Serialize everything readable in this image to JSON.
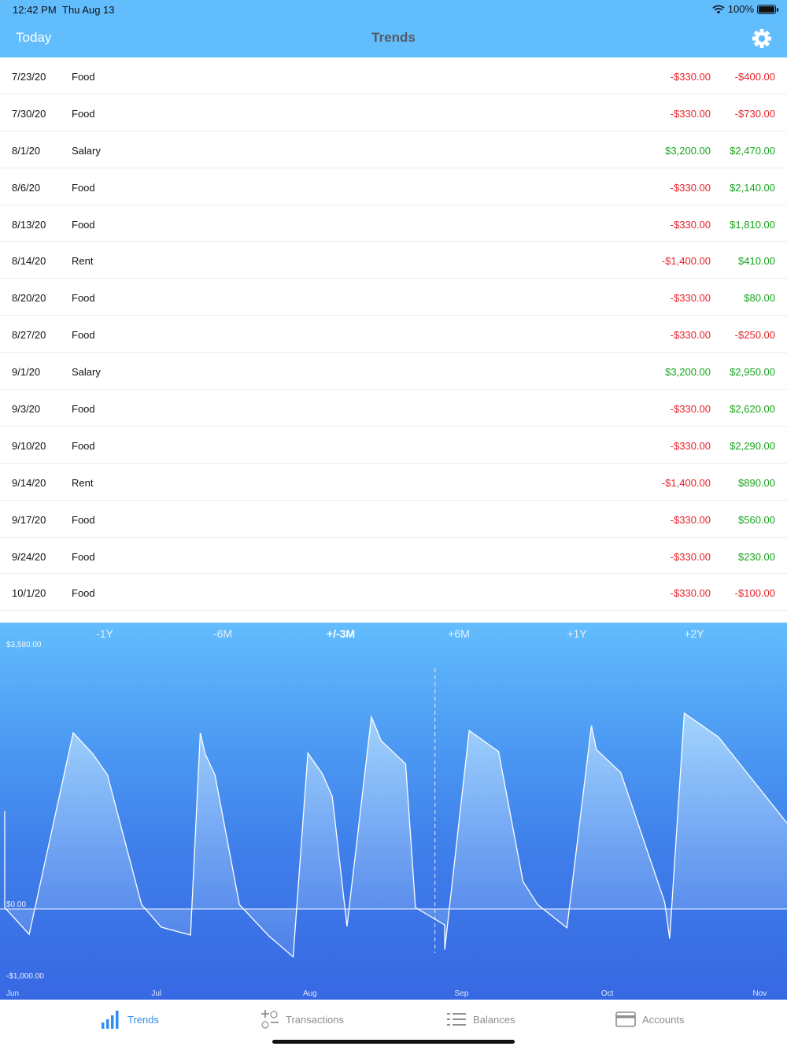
{
  "status": {
    "time": "12:42 PM",
    "date": "Thu Aug 13",
    "battery": "100%"
  },
  "nav": {
    "left": "Today",
    "title": "Trends"
  },
  "transactions": [
    {
      "date": "7/23/20",
      "category": "Food",
      "amount": "-$330.00",
      "balance": "-$400.00",
      "amount_sign": "neg",
      "balance_sign": "neg"
    },
    {
      "date": "7/30/20",
      "category": "Food",
      "amount": "-$330.00",
      "balance": "-$730.00",
      "amount_sign": "neg",
      "balance_sign": "neg"
    },
    {
      "date": "8/1/20",
      "category": "Salary",
      "amount": "$3,200.00",
      "balance": "$2,470.00",
      "amount_sign": "pos",
      "balance_sign": "pos"
    },
    {
      "date": "8/6/20",
      "category": "Food",
      "amount": "-$330.00",
      "balance": "$2,140.00",
      "amount_sign": "neg",
      "balance_sign": "pos"
    },
    {
      "date": "8/13/20",
      "category": "Food",
      "amount": "-$330.00",
      "balance": "$1,810.00",
      "amount_sign": "neg",
      "balance_sign": "pos"
    },
    {
      "date": "8/14/20",
      "category": "Rent",
      "amount": "-$1,400.00",
      "balance": "$410.00",
      "amount_sign": "neg",
      "balance_sign": "pos"
    },
    {
      "date": "8/20/20",
      "category": "Food",
      "amount": "-$330.00",
      "balance": "$80.00",
      "amount_sign": "neg",
      "balance_sign": "pos"
    },
    {
      "date": "8/27/20",
      "category": "Food",
      "amount": "-$330.00",
      "balance": "-$250.00",
      "amount_sign": "neg",
      "balance_sign": "neg"
    },
    {
      "date": "9/1/20",
      "category": "Salary",
      "amount": "$3,200.00",
      "balance": "$2,950.00",
      "amount_sign": "pos",
      "balance_sign": "pos"
    },
    {
      "date": "9/3/20",
      "category": "Food",
      "amount": "-$330.00",
      "balance": "$2,620.00",
      "amount_sign": "neg",
      "balance_sign": "pos"
    },
    {
      "date": "9/10/20",
      "category": "Food",
      "amount": "-$330.00",
      "balance": "$2,290.00",
      "amount_sign": "neg",
      "balance_sign": "pos"
    },
    {
      "date": "9/14/20",
      "category": "Rent",
      "amount": "-$1,400.00",
      "balance": "$890.00",
      "amount_sign": "neg",
      "balance_sign": "pos"
    },
    {
      "date": "9/17/20",
      "category": "Food",
      "amount": "-$330.00",
      "balance": "$560.00",
      "amount_sign": "neg",
      "balance_sign": "pos"
    },
    {
      "date": "9/24/20",
      "category": "Food",
      "amount": "-$330.00",
      "balance": "$230.00",
      "amount_sign": "neg",
      "balance_sign": "pos"
    },
    {
      "date": "10/1/20",
      "category": "Food",
      "amount": "-$330.00",
      "balance": "-$100.00",
      "amount_sign": "neg",
      "balance_sign": "neg"
    }
  ],
  "range_buttons": [
    {
      "label": "-1Y",
      "active": false
    },
    {
      "label": "-6M",
      "active": false
    },
    {
      "label": "+/-3M",
      "active": true
    },
    {
      "label": "+6M",
      "active": false
    },
    {
      "label": "+1Y",
      "active": false
    },
    {
      "label": "+2Y",
      "active": false
    }
  ],
  "chart_data": {
    "type": "area",
    "ylim": [
      -1000,
      3580
    ],
    "y_tick_labels": [
      "$3,580.00",
      "$0.00",
      "-$1,000.00"
    ],
    "x_tick_labels": [
      "Jun",
      "Jul",
      "Aug",
      "Sep",
      "Oct",
      "Nov"
    ],
    "xlim": [
      0,
      160
    ],
    "x_ticks": [
      0,
      30,
      61,
      92,
      122,
      153
    ],
    "today_marker_x": 88,
    "baseline": 0,
    "series": [
      {
        "x": [
          0,
          0,
          5,
          14,
          18,
          21,
          28,
          32,
          38,
          40,
          41,
          43,
          48,
          54,
          59,
          62,
          65,
          67,
          70,
          75,
          77,
          82,
          84,
          90,
          90,
          95,
          101,
          106,
          109,
          115,
          120,
          121,
          126,
          135,
          136,
          139,
          146,
          161,
          164,
          168,
          176
        ],
        "y": [
          1350,
          20,
          -350,
          2430,
          2140,
          1850,
          60,
          -250,
          -360,
          2430,
          2140,
          1850,
          60,
          -370,
          -660,
          2150,
          1860,
          1550,
          -240,
          2650,
          2320,
          2000,
          20,
          -220,
          -560,
          2460,
          2170,
          380,
          60,
          -260,
          2530,
          2200,
          1880,
          90,
          -410,
          2700,
          2370,
          1100,
          860,
          -100,
          -100
        ]
      }
    ]
  },
  "tabs": [
    {
      "label": "Trends",
      "icon": "trends-icon",
      "active": true
    },
    {
      "label": "Transactions",
      "icon": "transactions-icon",
      "active": false
    },
    {
      "label": "Balances",
      "icon": "balances-icon",
      "active": false
    },
    {
      "label": "Accounts",
      "icon": "accounts-icon",
      "active": false
    }
  ],
  "colors": {
    "accent": "#2f8ff0",
    "negative": "#e8232a",
    "positive": "#17a51b",
    "header": "#62bdfd"
  }
}
